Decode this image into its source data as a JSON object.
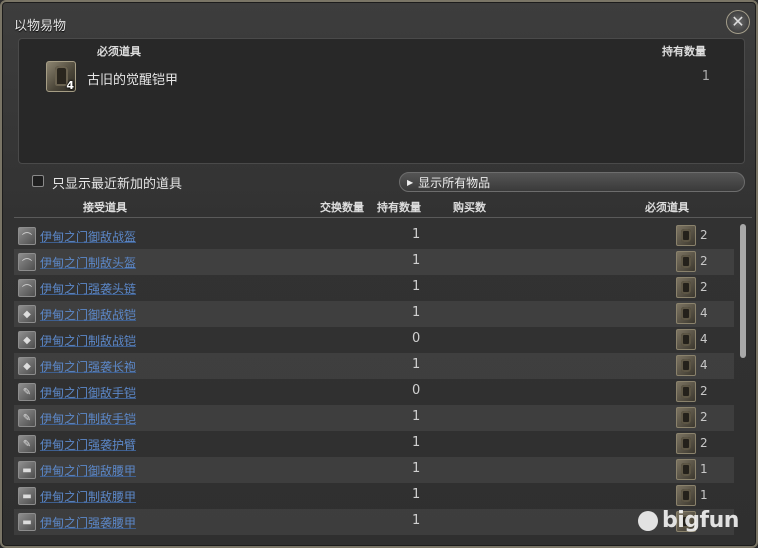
{
  "window": {
    "title": "以物易物",
    "close_icon": "close-icon"
  },
  "required_panel": {
    "col_name": "必须道具",
    "col_owned": "持有数量",
    "item": {
      "name": "古旧的觉醒铠甲",
      "icon_qty": "4",
      "owned": "1"
    }
  },
  "filter": {
    "checkbox_label": "只显示最近新加的道具",
    "checked": false,
    "show_all_label": "显示所有物品"
  },
  "table": {
    "headers": {
      "receive": "接受道具",
      "exchange_qty": "交换数量",
      "owned_qty": "持有数量",
      "buy_qty": "购买数",
      "required": "必须道具"
    },
    "rows": [
      {
        "name": "伊甸之门御敌战盔",
        "owned": "1",
        "req_qty": "2",
        "icon": "helmet-icon"
      },
      {
        "name": "伊甸之门制敌头盔",
        "owned": "1",
        "req_qty": "2",
        "icon": "helmet-icon"
      },
      {
        "name": "伊甸之门强袭头链",
        "owned": "1",
        "req_qty": "2",
        "icon": "helmet-icon"
      },
      {
        "name": "伊甸之门御敌战铠",
        "owned": "1",
        "req_qty": "4",
        "icon": "armor-icon"
      },
      {
        "name": "伊甸之门制敌战铠",
        "owned": "0",
        "req_qty": "4",
        "icon": "armor-icon"
      },
      {
        "name": "伊甸之门强袭长袍",
        "owned": "1",
        "req_qty": "4",
        "icon": "armor-icon"
      },
      {
        "name": "伊甸之门御敌手铠",
        "owned": "0",
        "req_qty": "2",
        "icon": "gauntlet-icon"
      },
      {
        "name": "伊甸之门制敌手铠",
        "owned": "1",
        "req_qty": "2",
        "icon": "gauntlet-icon"
      },
      {
        "name": "伊甸之门强袭护臂",
        "owned": "1",
        "req_qty": "2",
        "icon": "gauntlet-icon"
      },
      {
        "name": "伊甸之门御敌腰甲",
        "owned": "1",
        "req_qty": "1",
        "icon": "belt-icon"
      },
      {
        "name": "伊甸之门制敌腰甲",
        "owned": "1",
        "req_qty": "1",
        "icon": "belt-icon"
      },
      {
        "name": "伊甸之门强袭腰甲",
        "owned": "1",
        "req_qty": "",
        "icon": "belt-icon"
      }
    ]
  },
  "watermark": "bigfun"
}
